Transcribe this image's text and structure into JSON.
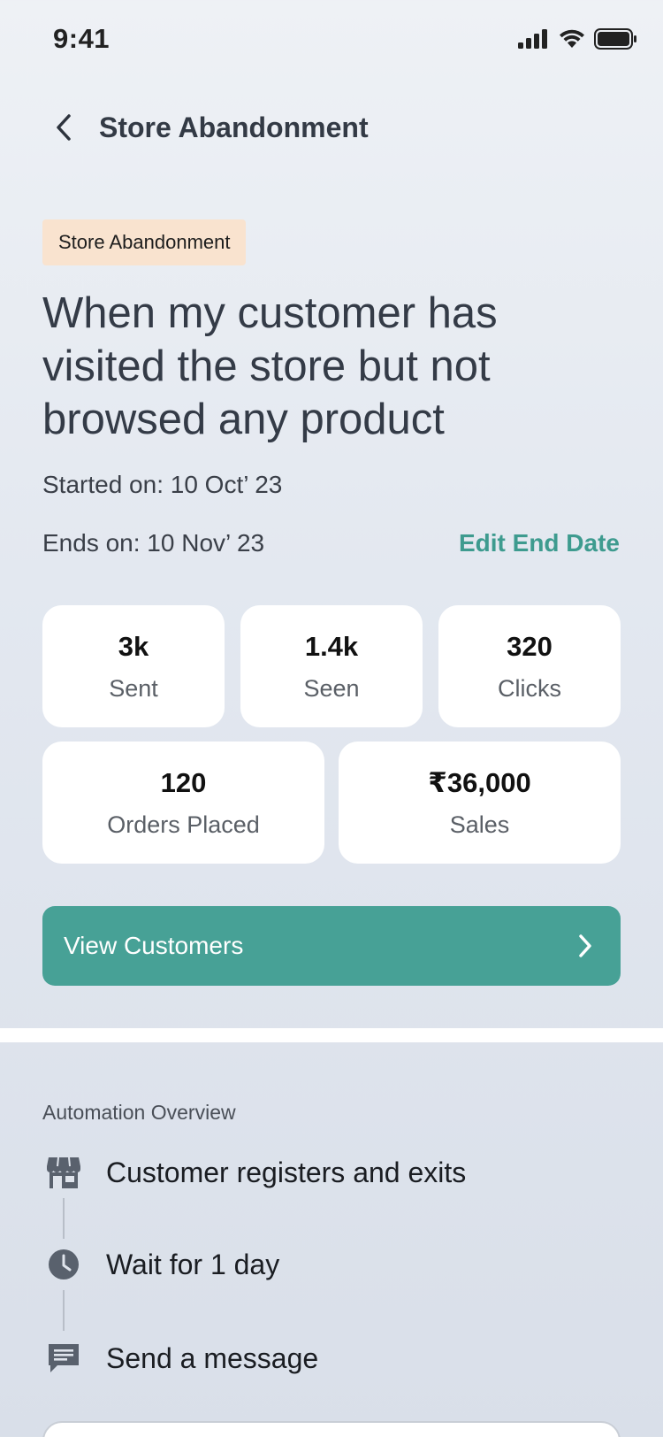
{
  "status": {
    "time": "9:41"
  },
  "header": {
    "title": "Store Abandonment"
  },
  "campaign": {
    "tag": "Store Abandonment",
    "headline": "When my customer has visited the store but not browsed any product",
    "started": "Started on: 10 Oct’ 23",
    "ends": "Ends on: 10 Nov’ 23",
    "edit_end_label": "Edit End Date"
  },
  "stats": [
    {
      "value": "3k",
      "label": "Sent"
    },
    {
      "value": "1.4k",
      "label": "Seen"
    },
    {
      "value": "320",
      "label": "Clicks"
    },
    {
      "value": "120",
      "label": "Orders Placed"
    },
    {
      "value": "₹36,000",
      "label": "Sales"
    }
  ],
  "view_customers": {
    "label": "View Customers"
  },
  "automation": {
    "title": "Automation Overview",
    "steps": [
      {
        "label": "Customer registers and exits",
        "icon": "store-icon"
      },
      {
        "label": "Wait for 1 day",
        "icon": "clock-icon"
      },
      {
        "label": "Send a message",
        "icon": "message-icon"
      }
    ]
  },
  "colors": {
    "accent": "#47a196",
    "tag_bg": "#f9e3cf"
  }
}
